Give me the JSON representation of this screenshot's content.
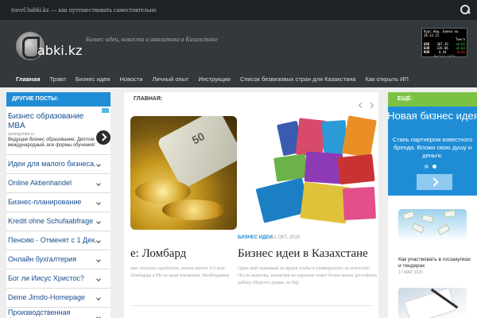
{
  "topbar": {
    "text": "travel.babki.kz — как путешествовать самостоятельно"
  },
  "header": {
    "logo_text": "abki.kz",
    "tagline": "Бизнес идеи, новости и аналитика в Казахстане",
    "ticker": {
      "title": "Курс Нац. Банка на 28.12.15",
      "col_header": "Тенге",
      "rows": [
        {
          "code": "USD",
          "value": "307.26",
          "change": "+0.01"
        },
        {
          "code": "EUR",
          "value": "326.06",
          "change": "+0.03"
        },
        {
          "code": "RUR",
          "value": "4.44",
          "change": "-0.01"
        }
      ],
      "brand": "kurlis.info"
    }
  },
  "nav": {
    "items": [
      {
        "label": "Главная",
        "active": true
      },
      {
        "label": "Трэвл"
      },
      {
        "label": "Бизнес идеи"
      },
      {
        "label": "Новости"
      },
      {
        "label": "Личный опыт"
      },
      {
        "label": "Инструкции"
      },
      {
        "label": "Список безвизовых стран для Казахстана"
      },
      {
        "label": "Как открыть ИП"
      }
    ]
  },
  "left": {
    "heading": "ДРУГИЕ ПОСТЫ:",
    "ad": {
      "title": "Бизнес образование MBA",
      "url": "synergymba.ru",
      "text": "Ведущее бизнес образование. Диплом международный, все формы обучения!"
    },
    "links": [
      "Идеи для малого бизнеса.",
      "Online Aktienhandel",
      "Бизнес-планирование",
      "Kredit ohne Schufaabfrage",
      "Пенсию - Отменят с 1 Дек.",
      "Онлайн бухгалтерия",
      "Бог ли Иисус Христос?",
      "Deine Jimdo-Homepage",
      "Производственная франши..."
    ]
  },
  "main": {
    "heading": "ГЛАВНАЯ:",
    "img1_label": "50",
    "post1": {
      "title": "е: Ломбард",
      "excerpt": "жно неплохо заработать, нигем хватит 3-5 млн. Ломбарды в РК не ьные вложения: Необходимое"
    },
    "post2": {
      "tag": "БИЗНЕС ИДЕИ",
      "date": "31 ОКТ, 2015",
      "title": "Бизнес идеи в Казахстане",
      "excerpt": "Один мой знакомый во время учебы в университете зи агентстве. После выпуска, несмотря на хорошие отмет более-менее достойную работу. Недолго думая, он бер"
    }
  },
  "right": {
    "heading": "ЕЩЁ:",
    "ad": {
      "title": "Новая бизнес идея",
      "subtitle": "Стань партнером известного бренда. Вложи свою душу и деньги."
    },
    "post1": {
      "title": "Как участвовать в госзакупках и тендерах",
      "date": "17 МАР, 2015"
    }
  }
}
